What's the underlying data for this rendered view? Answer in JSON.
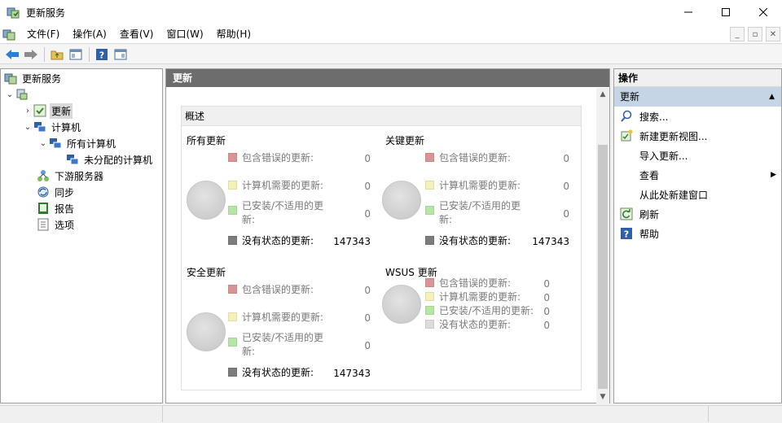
{
  "window": {
    "title": "更新服务"
  },
  "menubar": {
    "items": [
      "文件(F)",
      "操作(A)",
      "查看(V)",
      "窗口(W)",
      "帮助(H)"
    ]
  },
  "toolbar": {
    "icons": [
      "back-icon",
      "forward-icon",
      "up-folder-icon",
      "console-tree-icon",
      "help-icon",
      "action-pane-icon"
    ]
  },
  "tree": {
    "root": "更新服务",
    "items": [
      {
        "label": "更新",
        "icon": "updates-icon",
        "selected": true
      },
      {
        "label": "计算机",
        "icon": "computers-icon"
      },
      {
        "label": "所有计算机",
        "icon": "computers-icon"
      },
      {
        "label": "未分配的计算机",
        "icon": "computers-icon"
      },
      {
        "label": "下游服务器",
        "icon": "downstream-icon"
      },
      {
        "label": "同步",
        "icon": "sync-icon"
      },
      {
        "label": "报告",
        "icon": "reports-icon"
      },
      {
        "label": "选项",
        "icon": "options-icon"
      }
    ]
  },
  "center": {
    "header": "更新",
    "overview_title": "概述",
    "legend_colors": {
      "error": "#d99595",
      "needed": "#f5f0b8",
      "installed": "#b6e6a6",
      "no_status": "#7c7c7c"
    },
    "sections": [
      {
        "title": "所有更新",
        "rows": [
          {
            "label": "包含错误的更新:",
            "value": "0"
          },
          {
            "label": "计算机需要的更新:",
            "value": "0"
          },
          {
            "label": "已安装/不适用的更新:",
            "value": "0"
          },
          {
            "label": "没有状态的更新:",
            "value": "147343"
          }
        ]
      },
      {
        "title": "关键更新",
        "rows": [
          {
            "label": "包含错误的更新:",
            "value": "0"
          },
          {
            "label": "计算机需要的更新:",
            "value": "0"
          },
          {
            "label": "已安装/不适用的更新:",
            "value": "0"
          },
          {
            "label": "没有状态的更新:",
            "value": "147343"
          }
        ]
      },
      {
        "title": "安全更新",
        "rows": [
          {
            "label": "包含错误的更新:",
            "value": "0"
          },
          {
            "label": "计算机需要的更新:",
            "value": "0"
          },
          {
            "label": "已安装/不适用的更新:",
            "value": "0"
          },
          {
            "label": "没有状态的更新:",
            "value": "147343"
          }
        ]
      },
      {
        "title": "WSUS 更新",
        "rows": [
          {
            "label": "包含错误的更新:",
            "value": "0"
          },
          {
            "label": "计算机需要的更新:",
            "value": "0"
          },
          {
            "label": "已安装/不适用的更新:",
            "value": "0"
          },
          {
            "label": "没有状态的更新:",
            "value": "0"
          }
        ]
      }
    ]
  },
  "actions": {
    "header": "操作",
    "subheader": "更新",
    "items": [
      {
        "label": "搜索...",
        "icon": "search-icon"
      },
      {
        "label": "新建更新视图...",
        "icon": "new-view-icon"
      },
      {
        "label": "导入更新...",
        "icon": ""
      },
      {
        "label": "查看",
        "icon": ""
      },
      {
        "label": "从此处新建窗口",
        "icon": ""
      },
      {
        "label": "刷新",
        "icon": "refresh-icon"
      },
      {
        "label": "帮助",
        "icon": "help-icon"
      }
    ]
  }
}
